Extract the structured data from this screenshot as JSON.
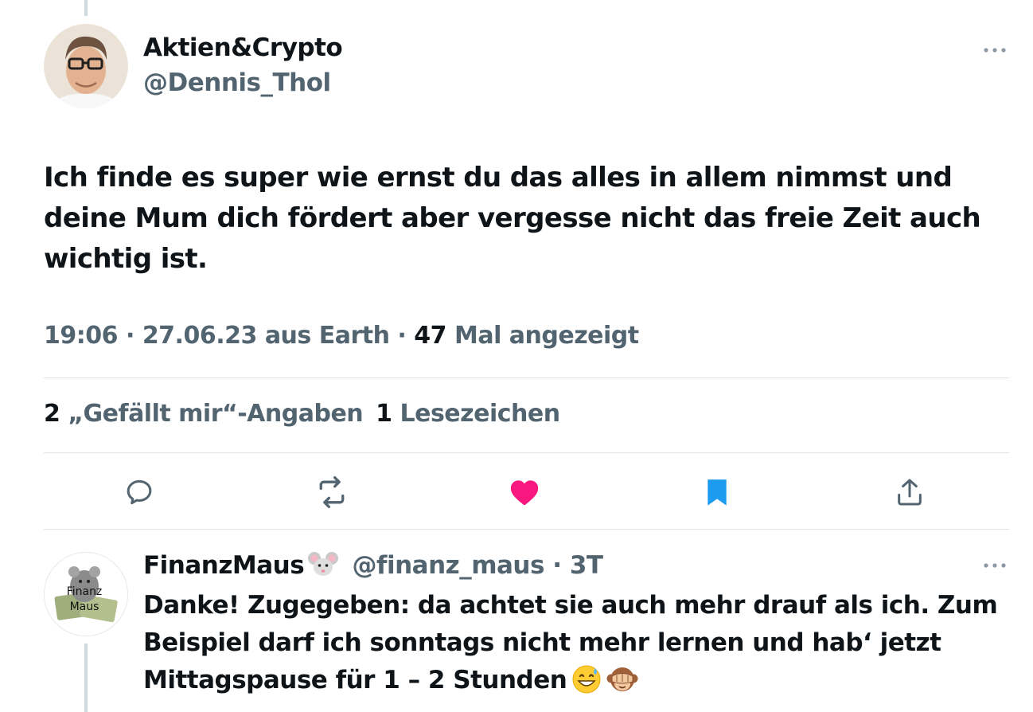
{
  "tweet": {
    "author_name": "Aktien&Crypto",
    "author_handle": "@Dennis_Thol",
    "text": "Ich finde es super wie ernst du das alles in allem nimmst und deine Mum dich fördert aber vergesse nicht das freie Zeit auch wichtig ist.",
    "time": "19:06",
    "date": "27.06.23",
    "source": "aus Earth",
    "separator": "·",
    "views_count": "47",
    "views_label": "Mal angezeigt",
    "likes_count": "2",
    "likes_label": "„Gefällt mir“-Angaben",
    "bookmarks_count": "1",
    "bookmarks_label": "Lesezeichen"
  },
  "actions": [
    {
      "name": "reply",
      "icon": "reply-icon"
    },
    {
      "name": "retweet",
      "icon": "retweet-icon"
    },
    {
      "name": "like",
      "icon": "heart-icon",
      "active": true,
      "color": "#f91880"
    },
    {
      "name": "bookmark",
      "icon": "bookmark-icon",
      "active": true,
      "color": "#1d9bf0"
    },
    {
      "name": "share",
      "icon": "share-icon"
    }
  ],
  "reply": {
    "author_name": "FinanzMaus",
    "author_emoji": "mouse-face-emoji",
    "author_handle": "@finanz_maus",
    "separator": "·",
    "time_ago": "3T",
    "avatar_label": "Finanz Maus",
    "text": "Danke! Zugegeben: da achtet sie auch mehr drauf als ich. Zum Beispiel darf ich sonntags nicht mehr lernen und hab‘ jetzt Mittagspause für 1 – 2 Stunden",
    "trailing_emojis": [
      "grinning-sweat-emoji",
      "see-no-evil-monkey-emoji"
    ]
  },
  "colors": {
    "text_primary": "#0f1419",
    "text_secondary": "#536471",
    "divider": "#dfe3e6",
    "thread_line": "#cfd9de",
    "like": "#f91880",
    "bookmark": "#1d9bf0"
  }
}
